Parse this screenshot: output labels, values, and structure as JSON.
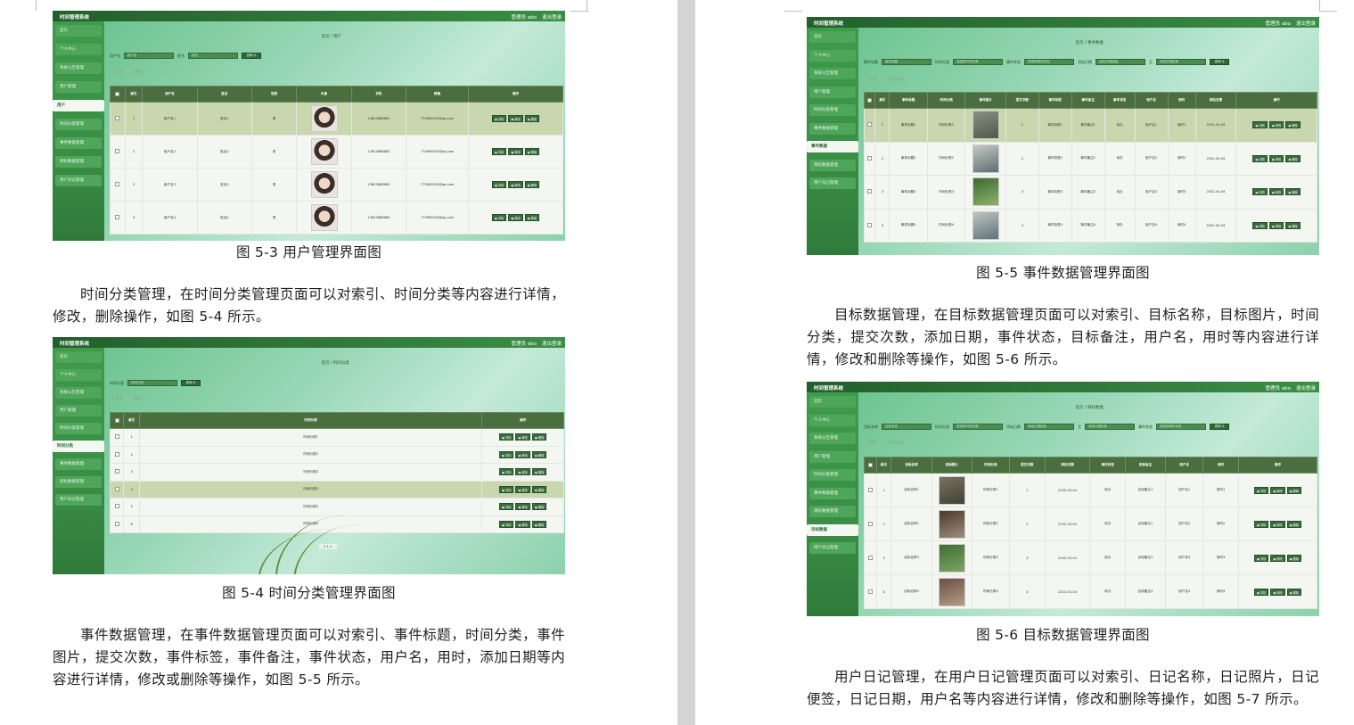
{
  "left_page": {
    "fig3": {
      "caption": "图 5-3 用户管理界面图",
      "app_title": "时间管理系统",
      "top_right": [
        "管理员 abo",
        "退出登录"
      ],
      "menu": [
        "首页",
        "个人中心",
        "系统公告管理",
        "用户管理"
      ],
      "submenu": "用户",
      "menu_after": [
        "时间分类管理",
        "事件数据管理",
        "目标数据管理",
        "用户日记管理"
      ],
      "breadcrumb": "首页 / 用户",
      "search": {
        "f1_label": "用户名",
        "f1_ph": "用户名",
        "f2_label": "姓名",
        "f2_ph": "姓名",
        "btn": "查询 Q"
      },
      "actions": [
        "新增",
        "删除"
      ],
      "headers": [
        "",
        "索引",
        "用户名",
        "姓名",
        "性别",
        "头像",
        "手机",
        "邮箱",
        "操作"
      ],
      "rows": [
        [
          "1",
          "用户名1",
          "姓名1",
          "男",
          "13823888881",
          "773890001@qq.com"
        ],
        [
          "2",
          "用户名2",
          "姓名2",
          "男",
          "13823888882",
          "773890002@qq.com"
        ],
        [
          "3",
          "用户名3",
          "姓名3",
          "男",
          "13823888883",
          "773890003@qq.com"
        ],
        [
          "4",
          "用户名4",
          "姓名4",
          "男",
          "13823888884",
          "773890004@qq.com"
        ]
      ],
      "op_buttons": [
        "详情",
        "修改",
        "删除"
      ]
    },
    "para1": "时间分类管理，在时间分类管理页面可以对索引、时间分类等内容进行详情，修改，删除操作，如图 5-4 所示。",
    "fig4": {
      "caption": "图 5-4 时间分类管理界面图",
      "app_title": "时间管理系统",
      "top_right": [
        "管理员 abo",
        "退出登录"
      ],
      "menu": [
        "首页",
        "个人中心",
        "系统公告管理",
        "用户管理",
        "时间分类管理"
      ],
      "submenu": "时间分类",
      "menu_after": [
        "事件数据管理",
        "目标数据管理",
        "用户日记管理"
      ],
      "breadcrumb": "首页 / 时间分类",
      "search": {
        "f1_label": "时间分类",
        "f1_ph": "时间分类",
        "btn": "查询 Q"
      },
      "actions": [
        "新增",
        "删除"
      ],
      "headers": [
        "",
        "索引",
        "时间分类",
        "操作"
      ],
      "rows": [
        [
          "1",
          "时间分类1"
        ],
        [
          "2",
          "时间分类2"
        ],
        [
          "3",
          "时间分类3"
        ],
        [
          "4",
          "时间分类4"
        ],
        [
          "5",
          "时间分类5"
        ],
        [
          "6",
          "时间分类6"
        ]
      ],
      "op_buttons": [
        "详情",
        "修改",
        "删除"
      ],
      "pager": "< 1 >"
    },
    "para2": "事件数据管理，在事件数据管理页面可以对索引、事件标题，时间分类，事件图片，提交次数，事件标签，事件备注，事件状态，用户名，用时，添加日期等内容进行详情，修改或删除等操作，如图 5-5 所示。"
  },
  "right_page": {
    "fig5": {
      "caption": "图 5-5 事件数据管理界面图",
      "app_title": "时间管理系统",
      "top_right": [
        "管理员 abo",
        "退出登录"
      ],
      "menu": [
        "首页",
        "个人中心",
        "系统公告管理",
        "用户管理",
        "时间分类管理",
        "事件数据管理"
      ],
      "submenu": "事件数据",
      "menu_after": [
        "目标数据管理",
        "用户日记管理"
      ],
      "breadcrumb": "首页 / 事件数据",
      "search": {
        "f1_label": "事件标题",
        "f1_ph": "事件标题",
        "f2_label": "时间分类",
        "f2_ph": "请选择时间分类",
        "f3_label": "事件状态",
        "f3_ph": "请选择事件状态",
        "f4_label": "添加日期",
        "f4_ph": "添加日期起始",
        "sep": "至",
        "f5_ph": "添加日期结束",
        "btn": "查询 Q"
      },
      "actions": [
        "删除",
        "统计报表"
      ],
      "headers": [
        "",
        "索引",
        "事件标题",
        "时间分类",
        "事件图片",
        "提交次数",
        "事件标签",
        "事件备注",
        "事件状态",
        "用户名",
        "用时",
        "添加日期",
        "操作"
      ],
      "rows": [
        [
          "1",
          "事件标题1",
          "时间分类1",
          "1",
          "事件标签1",
          "事件备注1",
          "待办",
          "用户名1",
          "用时1",
          "2022-03-04"
        ],
        [
          "2",
          "事件标题2",
          "时间分类2",
          "2",
          "事件标签2",
          "事件备注2",
          "待办",
          "用户名2",
          "用时2",
          "2022-03-04"
        ],
        [
          "3",
          "事件标题3",
          "时间分类3",
          "3",
          "事件标签3",
          "事件备注3",
          "待办",
          "用户名3",
          "用时3",
          "2022-03-04"
        ],
        [
          "4",
          "事件标题4",
          "时间分类4",
          "4",
          "事件标签4",
          "事件备注4",
          "待办",
          "用户名4",
          "用时4",
          "2022-03-04"
        ]
      ],
      "op_buttons": [
        "详情",
        "修改",
        "删除"
      ]
    },
    "para3": "目标数据管理，在目标数据管理页面可以对索引、目标名称，目标图片，时间分类，提交次数，添加日期，事件状态，目标备注，用户名，用时等内容进行详情，修改和删除等操作，如图 5-6 所示。",
    "fig6": {
      "caption": "图 5-6 目标数据管理界面图",
      "app_title": "时间管理系统",
      "top_right": [
        "管理员 abo",
        "退出登录"
      ],
      "menu": [
        "首页",
        "个人中心",
        "系统公告管理",
        "用户管理",
        "时间分类管理",
        "事件数据管理",
        "目标数据管理"
      ],
      "submenu": "目标数据",
      "menu_after": [
        "用户日记管理"
      ],
      "breadcrumb": "首页 / 目标数据",
      "search": {
        "f1_label": "目标名称",
        "f1_ph": "目标名称",
        "f2_label": "时间分类",
        "f2_ph": "请选择时间分类",
        "f3_label": "添加日期",
        "f3_ph": "添加日期起始",
        "sep": "至",
        "f4_ph": "添加日期结束",
        "f5_label": "事件状态",
        "f5_ph": "请选择事件状态",
        "btn": "查询 Q"
      },
      "actions": [
        "删除",
        "统计报表"
      ],
      "headers": [
        "",
        "索引",
        "目标名称",
        "目标图片",
        "时间分类",
        "提交次数",
        "添加日期",
        "事件状态",
        "目标备注",
        "用户名",
        "用时",
        "操作"
      ],
      "rows": [
        [
          "1",
          "目标名称1",
          "时间分类1",
          "1",
          "2022-03-04",
          "待办",
          "目标备注1",
          "用户名1",
          "用时1"
        ],
        [
          "2",
          "目标名称2",
          "时间分类2",
          "2",
          "2022-03-04",
          "待办",
          "目标备注2",
          "用户名2",
          "用时2"
        ],
        [
          "3",
          "目标名称3",
          "时间分类3",
          "3",
          "2022-03-04",
          "待办",
          "目标备注3",
          "用户名3",
          "用时3"
        ],
        [
          "4",
          "目标名称4",
          "时间分类4",
          "4",
          "2022-03-04",
          "待办",
          "目标备注4",
          "用户名4",
          "用时4"
        ]
      ],
      "op_buttons": [
        "详情",
        "修改",
        "删除"
      ]
    },
    "para4": "用户日记管理，在用户日记管理页面可以对索引、日记名称，日记照片，日记便签，日记日期，用户名等内容进行详情，修改和删除等操作，如图 5-7 所示。"
  },
  "colors": {
    "header_green": "#235f2c",
    "sidebar_green": "#3e9b4b",
    "table_head": "#4b6e3f",
    "highlight_row": "#c8d7ad"
  }
}
